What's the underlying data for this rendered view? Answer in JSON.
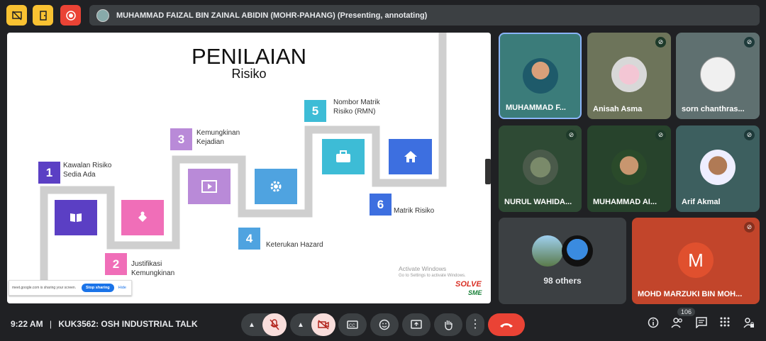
{
  "topbar": {
    "btn1_icon": "presentation-off-icon",
    "btn2_icon": "door-icon",
    "btn3_icon": "record-icon",
    "presenter_text": "MUHAMMAD FAIZAL BIN ZAINAL ABIDIN (MOHR-PAHANG) (Presenting, annotating)"
  },
  "slide": {
    "title": "PENILAIAN",
    "subtitle": "Risiko",
    "steps": [
      {
        "num": "1",
        "label_l1": "Kawalan Risiko",
        "label_l2": "Sedia Ada"
      },
      {
        "num": "2",
        "label_l1": "Justifikasi",
        "label_l2": "Kemungkinan"
      },
      {
        "num": "3",
        "label_l1": "Kemungkinan",
        "label_l2": "Kejadian"
      },
      {
        "num": "4",
        "label_l1": "Keterukan Hazard",
        "label_l2": ""
      },
      {
        "num": "5",
        "label_l1": "Nombor Matrik",
        "label_l2": "Risiko (RMN)"
      },
      {
        "num": "6",
        "label_l1": "Matrik Risiko",
        "label_l2": ""
      }
    ],
    "activate_l1": "Activate Windows",
    "activate_l2": "Go to Settings to activate Windows.",
    "logo_text_1": "SOLVE",
    "logo_text_2": "SME",
    "share_text": "meet.google.com is sharing your screen.",
    "stop_label": "Stop sharing",
    "hide_label": "Hide"
  },
  "participants": [
    {
      "name": "MUHAMMAD F..."
    },
    {
      "name": "Anisah Asma"
    },
    {
      "name": "sorn chanthras..."
    },
    {
      "name": "NURUL WAHIDA..."
    },
    {
      "name": "MUHAMMAD AI..."
    },
    {
      "name": "Arif Akmal"
    }
  ],
  "others_label": "98 others",
  "marzuki": {
    "initial": "M",
    "name": "MOHD MARZUKI BIN MOH..."
  },
  "bottombar": {
    "time": "9:22 AM",
    "separator": "|",
    "meeting": "KUK3562: OSH INDUSTRIAL TALK",
    "people_count": "106"
  },
  "colors": {
    "purple_dark": "#5b3fc4",
    "pink": "#f06eb8",
    "lavender": "#b98ad8",
    "blue_light": "#4fa3e0",
    "cyan": "#3dbcd6",
    "blue": "#3d6fe0",
    "end_call": "#ea4335",
    "muted": "#f9dedc"
  }
}
